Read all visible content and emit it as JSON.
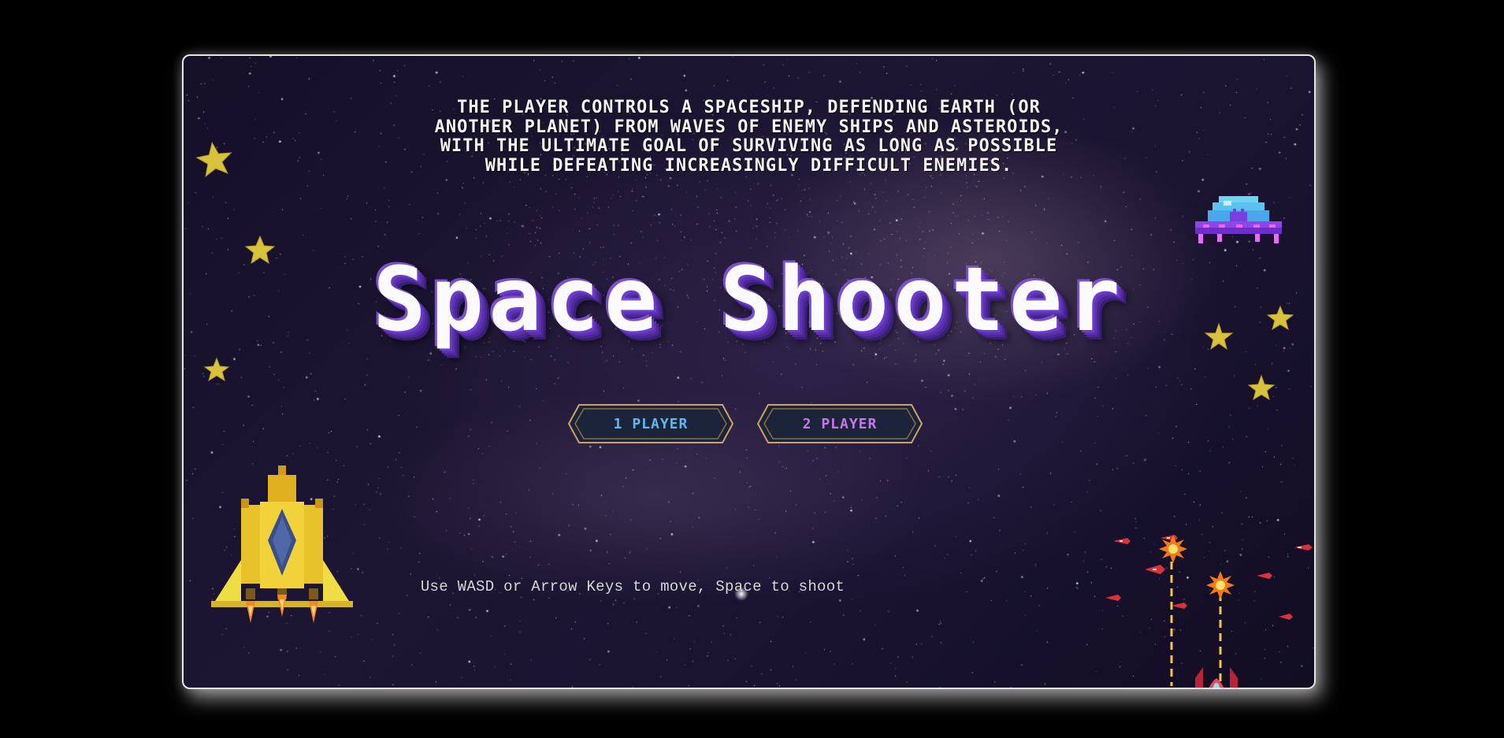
{
  "intro": {
    "line1": "THE PLAYER CONTROLS A SPACESHIP, DEFENDING EARTH (OR",
    "line2": "ANOTHER PLANET) FROM WAVES OF ENEMY SHIPS AND ASTEROIDS,",
    "line3": "WITH THE ULTIMATE GOAL OF SURVIVING AS LONG AS POSSIBLE",
    "line4": "WHILE DEFEATING INCREASINGLY DIFFICULT ENEMIES."
  },
  "title": "Space Shooter",
  "menu": {
    "one_player": "1 PLAYER",
    "two_player": "2 PLAYER"
  },
  "controls_hint": "Use WASD or Arrow Keys to move, Space to shoot",
  "colors": {
    "title_shadow": "#6b3dc8",
    "one_player_text": "#5fb8ee",
    "two_player_text": "#c776ee",
    "button_fill": "#1b2438",
    "button_border": "#c9a46a",
    "star_yellow": "#d8c23c"
  },
  "icons": [
    "star-icon",
    "ufo-icon",
    "yellow-spaceship-icon",
    "red-rocket-icon",
    "enemy-ship-icon",
    "explosion-icon"
  ]
}
